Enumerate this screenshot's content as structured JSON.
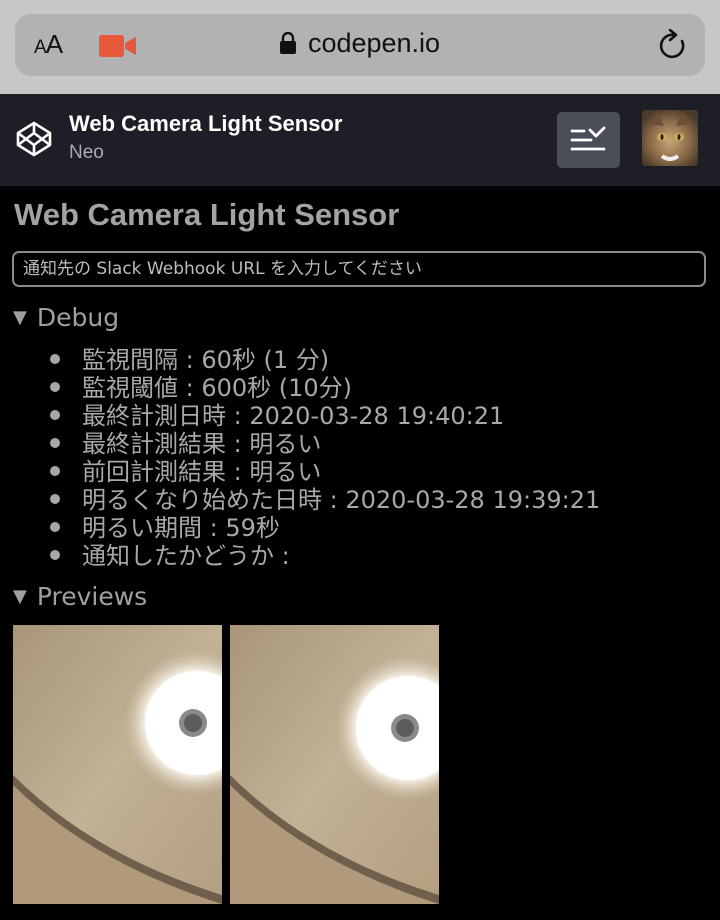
{
  "browser": {
    "text_size_label": "AA",
    "url": "codepen.io",
    "camera_color": "#e8573a"
  },
  "pen": {
    "title": "Web Camera Light Sensor",
    "author": "Neo"
  },
  "page": {
    "heading": "Web Camera Light Sensor",
    "webhook_placeholder": "通知先の Slack Webhook URL を入力してください",
    "debug_summary": "Debug",
    "debug_items": [
      "監視間隔 : 60秒 (1 分)",
      "監視閾値 : 600秒 (10分)",
      "最終計測日時 : 2020-03-28 19:40:21",
      "最終計測結果 : 明るい",
      "前回計測結果 : 明るい",
      "明るくなり始めた日時 : 2020-03-28 19:39:21",
      "明るい期間 : 59秒",
      "通知したかどうか :"
    ],
    "previews_summary": "Previews"
  }
}
